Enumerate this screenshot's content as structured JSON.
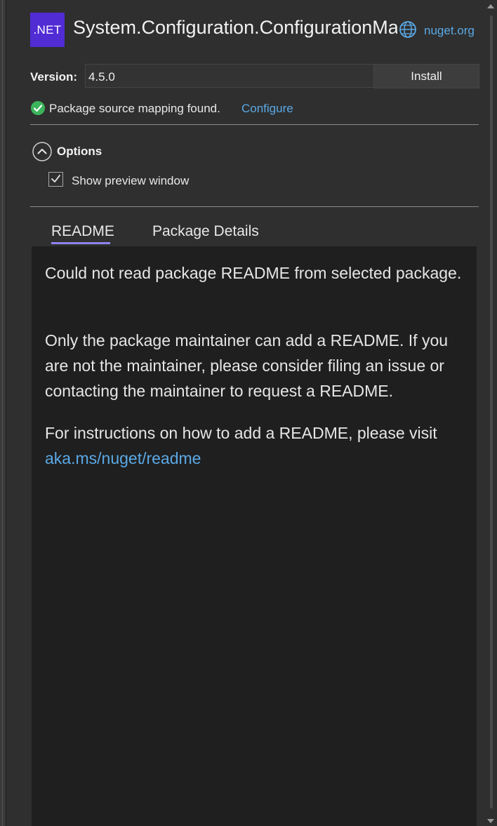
{
  "header": {
    "logo_text": ".NET",
    "package_title": "System.Configuration.ConfigurationManager",
    "source_label": "nuget.org"
  },
  "version": {
    "label": "Version:",
    "selected": "4.5.0",
    "install_label": "Install"
  },
  "mapping": {
    "status_text": "Package source mapping found.",
    "configure_label": "Configure"
  },
  "options": {
    "label": "Options",
    "show_preview_label": "Show preview window",
    "show_preview_checked": true
  },
  "tabs": {
    "readme": "README",
    "details": "Package Details"
  },
  "readme": {
    "line1": "Could not read package README from selected package.",
    "line2": "Only the package maintainer can add a README. If you are not the maintainer, please consider filing an issue or contacting the maintainer to request a README.",
    "line3": "For instructions on how to add a README, please visit",
    "link": "aka.ms/nuget/readme"
  },
  "colors": {
    "accent": "#512bd4",
    "link": "#5aa9e6",
    "tab_underline": "#8f84f0",
    "success": "#3cb45c"
  }
}
